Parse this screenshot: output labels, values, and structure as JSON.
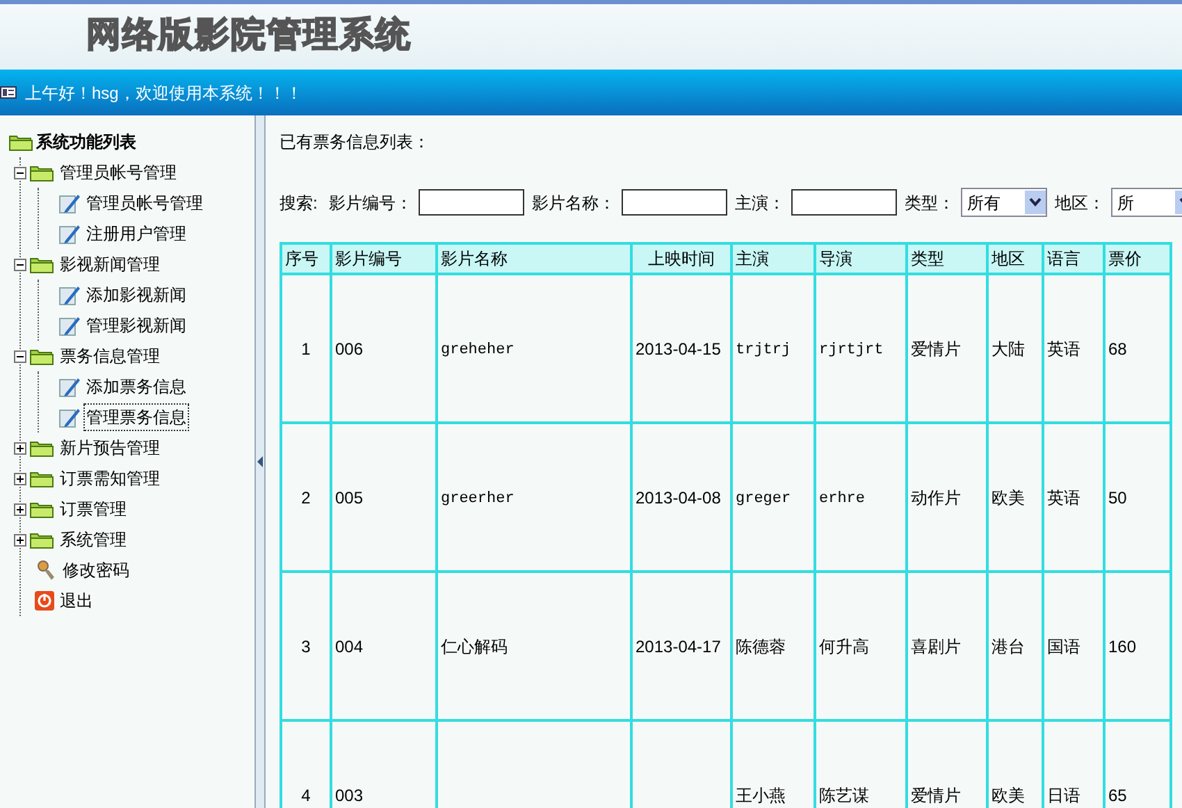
{
  "header": {
    "title": "网络版影院管理系统",
    "greeting": "上午好！hsg，欢迎使用本系统！！！"
  },
  "sidebar": {
    "root": "系统功能列表",
    "items": [
      {
        "label": "管理员帐号管理",
        "kind": "folder",
        "expanded": true,
        "children": [
          {
            "label": "管理员帐号管理",
            "kind": "page",
            "selected": false
          },
          {
            "label": "注册用户管理",
            "kind": "page",
            "selected": false
          }
        ]
      },
      {
        "label": "影视新闻管理",
        "kind": "folder",
        "expanded": true,
        "children": [
          {
            "label": "添加影视新闻",
            "kind": "page",
            "selected": false
          },
          {
            "label": "管理影视新闻",
            "kind": "page",
            "selected": false
          }
        ]
      },
      {
        "label": "票务信息管理",
        "kind": "folder",
        "expanded": true,
        "children": [
          {
            "label": "添加票务信息",
            "kind": "page",
            "selected": false
          },
          {
            "label": "管理票务信息",
            "kind": "page",
            "selected": true
          }
        ]
      },
      {
        "label": "新片预告管理",
        "kind": "folder",
        "expanded": false
      },
      {
        "label": "订票需知管理",
        "kind": "folder",
        "expanded": false
      },
      {
        "label": "订票管理",
        "kind": "folder",
        "expanded": false
      },
      {
        "label": "系统管理",
        "kind": "folder",
        "expanded": false
      },
      {
        "label": "修改密码",
        "kind": "key"
      },
      {
        "label": "退出",
        "kind": "exit"
      }
    ]
  },
  "content": {
    "heading": "已有票务信息列表：",
    "search_label": "搜索:",
    "filters": [
      {
        "label": "影片编号：",
        "kind": "text"
      },
      {
        "label": "影片名称：",
        "kind": "text"
      },
      {
        "label": "主演：",
        "kind": "text"
      },
      {
        "label": "类型：",
        "kind": "select",
        "value": "所有"
      },
      {
        "label": "地区：",
        "kind": "select",
        "value": "所"
      }
    ],
    "table": {
      "columns": [
        "序号",
        "影片编号",
        "影片名称",
        "上映时间",
        "主演",
        "导演",
        "类型",
        "地区",
        "语言",
        "票价"
      ],
      "rows": [
        {
          "no": "1",
          "code": "006",
          "name": "greheher",
          "date": "2013-04-15",
          "star": "trjtrj",
          "director": "rjrtjrt",
          "genre": "爱情片",
          "region": "大陆",
          "language": "英语",
          "price": "68"
        },
        {
          "no": "2",
          "code": "005",
          "name": "greerher",
          "date": "2013-04-08",
          "star": "greger",
          "director": "erhre",
          "genre": "动作片",
          "region": "欧美",
          "language": "英语",
          "price": "50"
        },
        {
          "no": "3",
          "code": "004",
          "name": "仁心解码",
          "date": "2013-04-17",
          "star": "陈德蓉",
          "director": "何升高",
          "genre": "喜剧片",
          "region": "港台",
          "language": "国语",
          "price": "160"
        },
        {
          "no": "4",
          "code": "003",
          "star": "王小燕",
          "director": "陈艺谋",
          "genre": "爱情片",
          "region": "欧美",
          "language": "日语",
          "price": "65"
        }
      ]
    }
  }
}
